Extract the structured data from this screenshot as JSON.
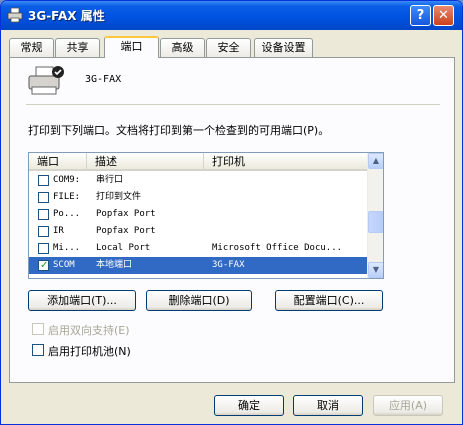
{
  "window": {
    "title": "3G-FAX 属性",
    "help_glyph": "?",
    "close_glyph": "✕"
  },
  "tabs": [
    "常规",
    "共享",
    "端口",
    "高级",
    "安全",
    "设备设置"
  ],
  "active_tab": 2,
  "printer": {
    "name": "3G-FAX"
  },
  "description": "打印到下列端口。文档将打印到第一个检查到的可用端口(P)。",
  "ports": {
    "columns": [
      "端口",
      "描述",
      "打印机"
    ],
    "rows": [
      {
        "port": "COM9:",
        "desc": "串行口",
        "printer": "",
        "checked": false,
        "selected": false
      },
      {
        "port": "FILE:",
        "desc": "打印到文件",
        "printer": "",
        "checked": false,
        "selected": false
      },
      {
        "port": "Po...",
        "desc": "Popfax Port",
        "printer": "",
        "checked": false,
        "selected": false
      },
      {
        "port": "IR",
        "desc": "Popfax Port",
        "printer": "",
        "checked": false,
        "selected": false
      },
      {
        "port": "Mi...",
        "desc": "Local Port",
        "printer": "Microsoft Office Docu...",
        "checked": false,
        "selected": false
      },
      {
        "port": "SCOM",
        "desc": "本地端口",
        "printer": "3G-FAX",
        "checked": true,
        "selected": true
      }
    ]
  },
  "buttons": {
    "add_port": "添加端口(T)...",
    "delete_port": "删除端口(D)",
    "configure_port": "配置端口(C)..."
  },
  "options": {
    "bidirectional": "启用双向支持(E)",
    "pooling": "启用打印机池(N)"
  },
  "footer": {
    "ok": "确定",
    "cancel": "取消",
    "apply": "应用(A)"
  },
  "colors": {
    "titlebar": "#0052e0",
    "selection": "#316ac5",
    "active_tab_accent": "#ffc83c"
  }
}
